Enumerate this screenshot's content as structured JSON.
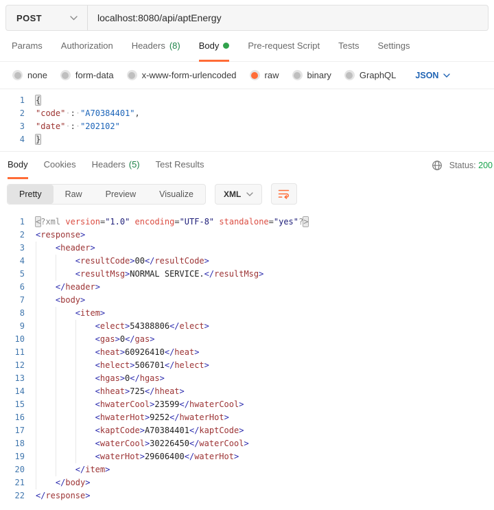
{
  "request_bar": {
    "method": "POST",
    "url": "localhost:8080/api/aptEnergy"
  },
  "request_tabs": [
    {
      "label": "Params"
    },
    {
      "label": "Authorization"
    },
    {
      "label": "Headers",
      "count": "(8)"
    },
    {
      "label": "Body",
      "active": true,
      "dot": true
    },
    {
      "label": "Pre-request Script"
    },
    {
      "label": "Tests"
    },
    {
      "label": "Settings"
    }
  ],
  "body_types": {
    "options": [
      {
        "label": "none"
      },
      {
        "label": "form-data"
      },
      {
        "label": "x-www-form-urlencoded"
      },
      {
        "label": "raw",
        "selected": true
      },
      {
        "label": "binary"
      },
      {
        "label": "GraphQL"
      }
    ],
    "language": "JSON"
  },
  "request_editor": {
    "lines": [
      {
        "n": 1,
        "tokens": [
          [
            "pun hl",
            "{"
          ]
        ]
      },
      {
        "n": 2,
        "tokens": [
          [
            "key",
            "\"code\""
          ],
          [
            "ws",
            "·"
          ],
          [
            "pun",
            ":"
          ],
          [
            "ws",
            "·"
          ],
          [
            "str",
            "\"A70384401\""
          ],
          [
            "pun",
            ","
          ]
        ]
      },
      {
        "n": 3,
        "tokens": [
          [
            "key",
            "\"date\""
          ],
          [
            "ws",
            "·"
          ],
          [
            "pun",
            ":"
          ],
          [
            "ws",
            "·"
          ],
          [
            "str",
            "\"202102\""
          ]
        ]
      },
      {
        "n": 4,
        "tokens": [
          [
            "pun hl",
            "}"
          ]
        ]
      }
    ]
  },
  "response_header": {
    "tabs": [
      {
        "label": "Body",
        "active": true
      },
      {
        "label": "Cookies"
      },
      {
        "label": "Headers",
        "count": "(5)"
      },
      {
        "label": "Test Results"
      }
    ],
    "status_label": "Status:",
    "status_value": "200"
  },
  "response_toolbar": {
    "views": [
      {
        "label": "Pretty",
        "active": true
      },
      {
        "label": "Raw"
      },
      {
        "label": "Preview"
      },
      {
        "label": "Visualize"
      }
    ],
    "format": "XML"
  },
  "response_editor": {
    "lines": [
      {
        "n": 1,
        "indent": 0,
        "type": "prolog",
        "attrs": [
          [
            "version",
            "1.0"
          ],
          [
            "encoding",
            "UTF-8"
          ],
          [
            "standalone",
            "yes"
          ]
        ]
      },
      {
        "n": 2,
        "indent": 0,
        "type": "open",
        "tag": "response"
      },
      {
        "n": 3,
        "indent": 1,
        "type": "open",
        "tag": "header"
      },
      {
        "n": 4,
        "indent": 2,
        "type": "leaf",
        "tag": "resultCode",
        "value": "00"
      },
      {
        "n": 5,
        "indent": 2,
        "type": "leaf",
        "tag": "resultMsg",
        "value": "NORMAL SERVICE."
      },
      {
        "n": 6,
        "indent": 1,
        "type": "close",
        "tag": "header"
      },
      {
        "n": 7,
        "indent": 1,
        "type": "open",
        "tag": "body"
      },
      {
        "n": 8,
        "indent": 2,
        "type": "open",
        "tag": "item"
      },
      {
        "n": 9,
        "indent": 3,
        "type": "leaf",
        "tag": "elect",
        "value": "54388806"
      },
      {
        "n": 10,
        "indent": 3,
        "type": "leaf",
        "tag": "gas",
        "value": "0"
      },
      {
        "n": 11,
        "indent": 3,
        "type": "leaf",
        "tag": "heat",
        "value": "60926410"
      },
      {
        "n": 12,
        "indent": 3,
        "type": "leaf",
        "tag": "helect",
        "value": "506701"
      },
      {
        "n": 13,
        "indent": 3,
        "type": "leaf",
        "tag": "hgas",
        "value": "0"
      },
      {
        "n": 14,
        "indent": 3,
        "type": "leaf",
        "tag": "hheat",
        "value": "725"
      },
      {
        "n": 15,
        "indent": 3,
        "type": "leaf",
        "tag": "hwaterCool",
        "value": "23599"
      },
      {
        "n": 16,
        "indent": 3,
        "type": "leaf",
        "tag": "hwaterHot",
        "value": "9252"
      },
      {
        "n": 17,
        "indent": 3,
        "type": "leaf",
        "tag": "kaptCode",
        "value": "A70384401"
      },
      {
        "n": 18,
        "indent": 3,
        "type": "leaf",
        "tag": "waterCool",
        "value": "30226450"
      },
      {
        "n": 19,
        "indent": 3,
        "type": "leaf",
        "tag": "waterHot",
        "value": "29606400"
      },
      {
        "n": 20,
        "indent": 2,
        "type": "close",
        "tag": "item"
      },
      {
        "n": 21,
        "indent": 1,
        "type": "close",
        "tag": "body"
      },
      {
        "n": 22,
        "indent": 0,
        "type": "close",
        "tag": "response"
      }
    ]
  },
  "colors": {
    "accent_orange": "#ff6c37",
    "count_green": "#1d8348",
    "status_green": "#17a24a",
    "link_blue": "#2064b4"
  }
}
